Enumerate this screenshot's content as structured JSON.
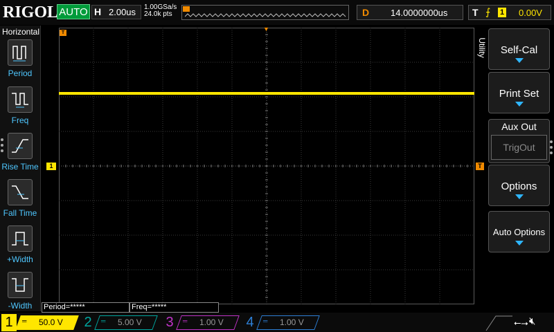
{
  "topbar": {
    "logo": "RIGOL",
    "run_mode": "AUTO",
    "horizontal_label": "H",
    "horizontal_value": "2.00us",
    "sample_rate": "1.00GSa/s",
    "memory_depth": "24.0k pts",
    "delay_label": "D",
    "delay_value": "14.0000000us",
    "trigger_label": "T",
    "trigger_source": "1",
    "trigger_level": "0.00V"
  },
  "left_menu": {
    "title": "Horizontal",
    "items": [
      {
        "label": "Period",
        "icon": "period-icon"
      },
      {
        "label": "Freq",
        "icon": "frequency-icon"
      },
      {
        "label": "Rise Time",
        "icon": "rise-time-icon"
      },
      {
        "label": "Fall Time",
        "icon": "fall-time-icon"
      },
      {
        "label": "+Width",
        "icon": "positive-width-icon"
      },
      {
        "label": "-Width",
        "icon": "negative-width-icon"
      }
    ]
  },
  "right_menu": {
    "tab_label": "Utility",
    "buttons": [
      {
        "label": "Self-Cal"
      },
      {
        "label": "Print Set"
      },
      {
        "label": "Options"
      },
      {
        "label": "Auto Options"
      }
    ],
    "aux_out": {
      "label": "Aux Out",
      "value": "TrigOut"
    }
  },
  "markers": {
    "trigger_position": "▼",
    "time_origin": "T",
    "channel1": "1",
    "trigger_level": "T"
  },
  "measurements": [
    {
      "label": "Period=*****"
    },
    {
      "label": "Freq=*****"
    }
  ],
  "channels": [
    {
      "num": "1",
      "scale": "50.0 V",
      "coupling": "═",
      "color": "#ffe600",
      "active": true
    },
    {
      "num": "2",
      "scale": "5.00 V",
      "coupling": "═",
      "color": "#00a7a0",
      "active": false
    },
    {
      "num": "3",
      "scale": "1.00 V",
      "coupling": "═",
      "color": "#c033c8",
      "active": false
    },
    {
      "num": "4",
      "scale": "1.00 V",
      "coupling": "═",
      "color": "#2d7fd6",
      "active": false
    }
  ],
  "waveform": {
    "channel": "1",
    "color": "#ffe600",
    "level_divisions_above_center": 2.1
  },
  "status_icons": [
    "usb-icon",
    "speaker-muted-icon"
  ],
  "colors": {
    "accent_orange": "#f08a00",
    "menu_arrow_blue": "#2fb6ff",
    "menu_label_blue": "#4fc7ff",
    "auto_green": "#009b3a"
  }
}
